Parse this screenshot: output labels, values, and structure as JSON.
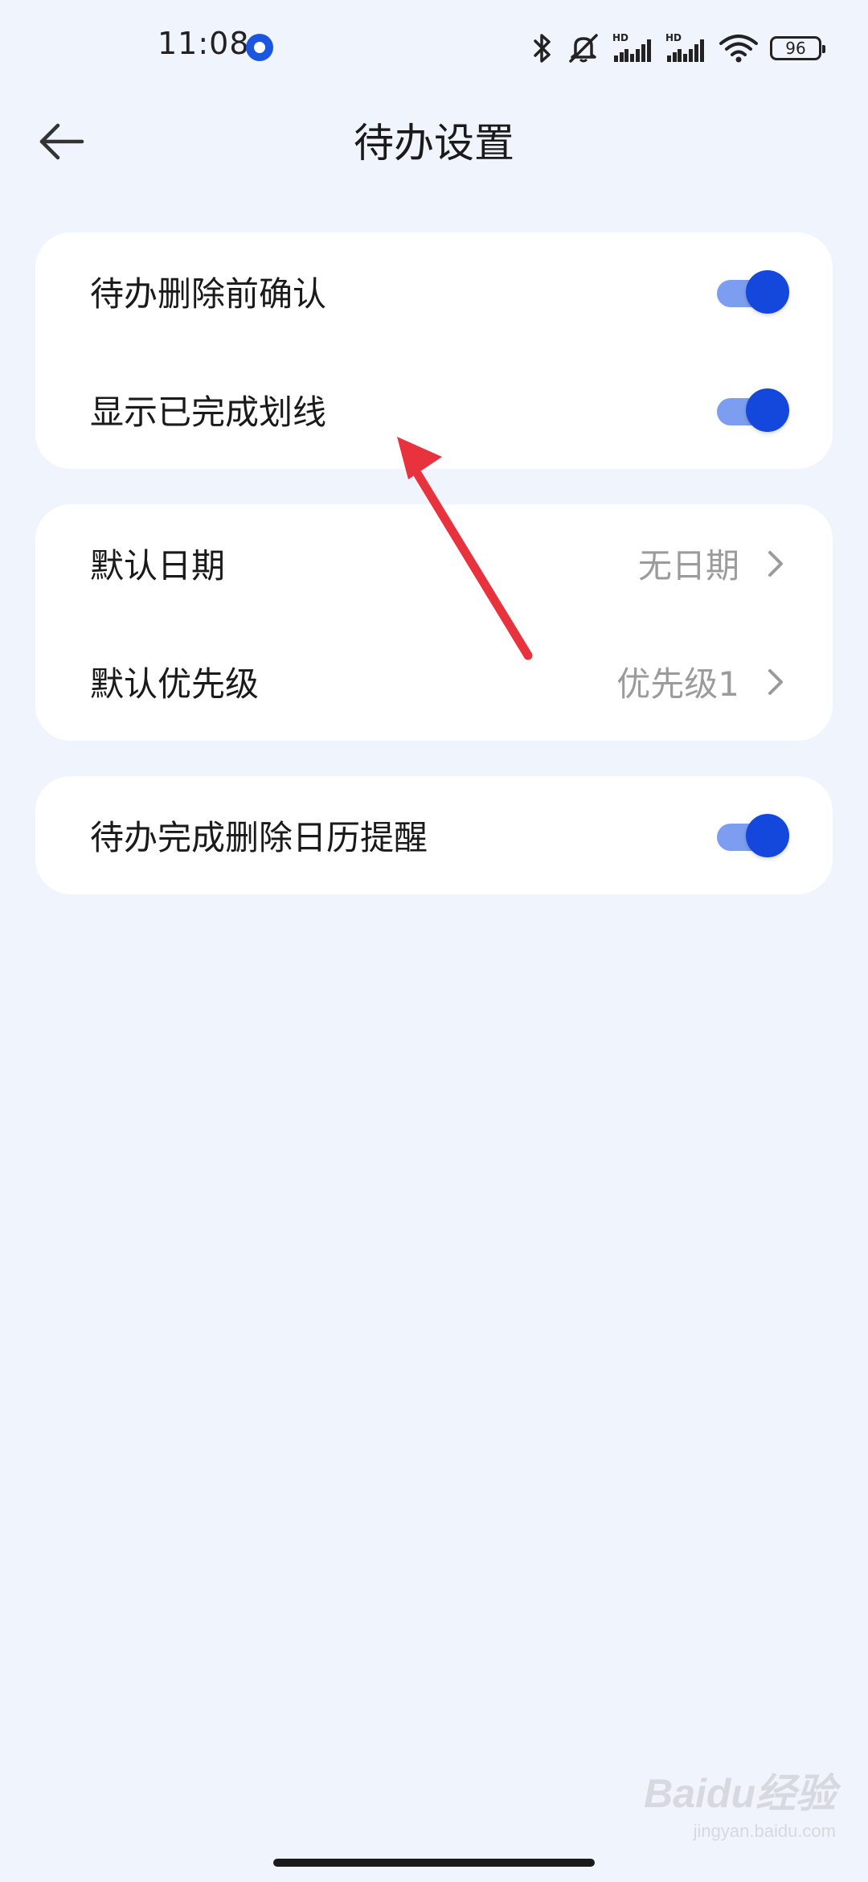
{
  "status_bar": {
    "time": "11:08",
    "battery": "96",
    "icons": [
      "app-notification-icon",
      "bluetooth-icon",
      "silent-icon",
      "hd-signal-icon",
      "hd-signal-icon",
      "wifi-icon",
      "battery-icon"
    ]
  },
  "header": {
    "title": "待办设置",
    "back_icon": "back-arrow-icon"
  },
  "groups": [
    {
      "items": [
        {
          "label": "待办删除前确认",
          "type": "toggle",
          "on": true
        },
        {
          "label": "显示已完成划线",
          "type": "toggle",
          "on": true
        }
      ]
    },
    {
      "items": [
        {
          "label": "默认日期",
          "type": "select",
          "value": "无日期"
        },
        {
          "label": "默认优先级",
          "type": "select",
          "value": "优先级1"
        }
      ]
    },
    {
      "items": [
        {
          "label": "待办完成删除日历提醒",
          "type": "toggle",
          "on": true
        }
      ]
    }
  ],
  "watermark": {
    "main": "Baidu经验",
    "sub": "jingyan.baidu.com"
  },
  "colors": {
    "background": "#f0f4fd",
    "card": "#ffffff",
    "toggle_knob": "#1447dc",
    "toggle_track": "#7d9ef0",
    "annotation_arrow": "#e8323e",
    "secondary_text": "#9b9b9b"
  }
}
